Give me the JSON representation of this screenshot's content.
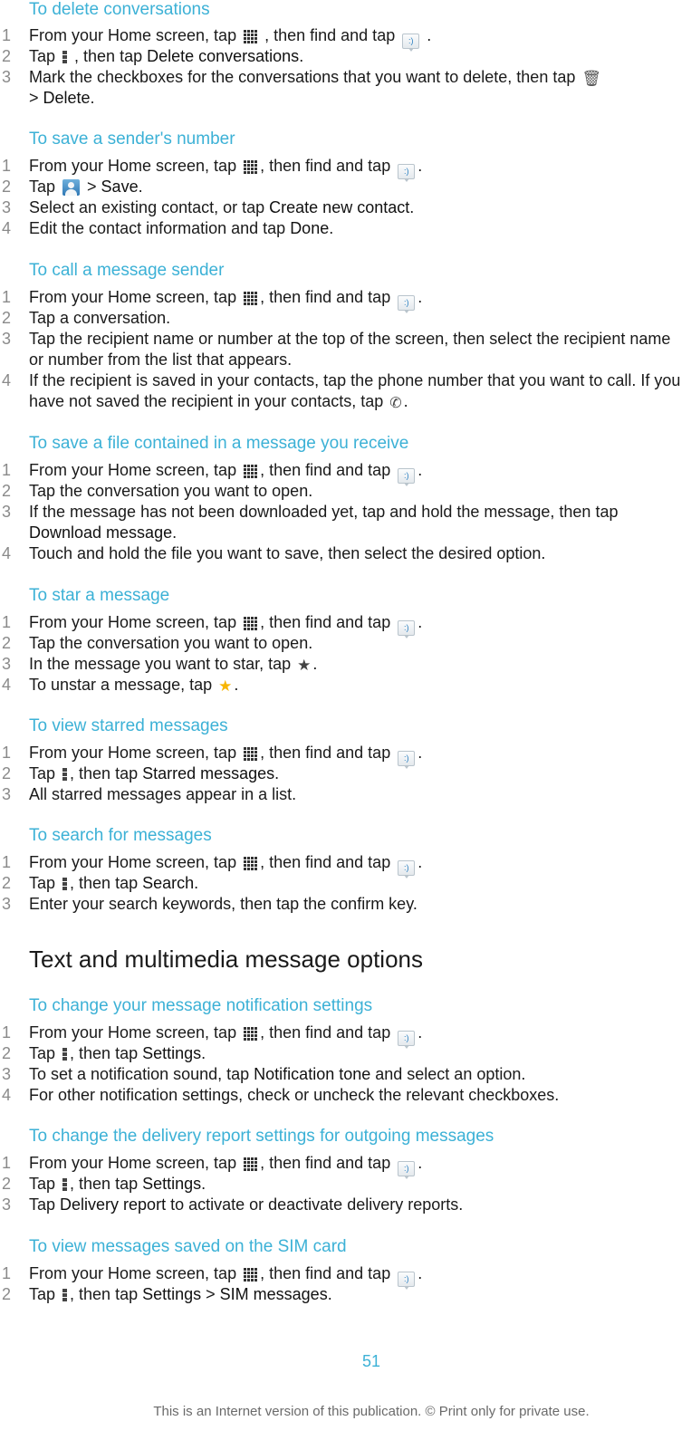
{
  "icons": {
    "apps_grid": "apps-grid-icon",
    "messaging": "messaging-icon",
    "menu": "menu-overflow-icon",
    "contact": "contact-icon",
    "trash": "trash-icon",
    "phone": "phone-icon",
    "star_dark": "star-icon",
    "star_gold": "star-filled-icon",
    "msg_glyph": ":)",
    "star_glyph": "★",
    "phone_glyph": "✆",
    "trash_glyph": "🗑"
  },
  "common": {
    "from_home_a": "From your Home screen, tap ",
    "from_home_b": ", then find and tap ",
    "period": ".",
    "tap": "Tap ",
    "then_tap": ", then tap "
  },
  "sections": {
    "delete": {
      "title": "To delete conversations",
      "step1_a": "From your Home screen, tap ",
      "step1_b": " , then find and tap ",
      "step1_c": " .",
      "step2_a": "Tap ",
      "step2_b": " , then tap ",
      "step2_bold": "Delete conversations",
      "step2_c": ".",
      "step3_a": "Mark the checkboxes for the conversations that you want to delete, then tap ",
      "step3_b": " > ",
      "step3_bold": "Delete",
      "step3_c": "."
    },
    "save_number": {
      "title": "To save a sender's number",
      "step2_b": " > ",
      "step2_bold": "Save",
      "step3_a": "Select an existing contact, or tap ",
      "step3_bold": "Create new contact",
      "step4_a": "Edit the contact information and tap ",
      "step4_bold": "Done"
    },
    "call_sender": {
      "title": "To call a message sender",
      "step2": "Tap a conversation.",
      "step3": "Tap the recipient name or number at the top of the screen, then select the recipient name or number from the list that appears.",
      "step4": "If the recipient is saved in your contacts, tap the phone number that you want to call. If you have not saved the recipient in your contacts, tap "
    },
    "save_file": {
      "title": "To save a file contained in a message you receive",
      "step2": "Tap the conversation you want to open.",
      "step3_a": "If the message has not been downloaded yet, tap and hold the message, then tap ",
      "step3_bold": "Download message",
      "step4": "Touch and hold the file you want to save, then select the desired option."
    },
    "star_message": {
      "title": "To star a message",
      "step2": "Tap the conversation you want to open.",
      "step3": "In the message you want to star, tap ",
      "step4": "To unstar a message, tap "
    },
    "view_starred": {
      "title": "To view starred messages",
      "step2_bold": "Starred messages",
      "step3": "All starred messages appear in a list."
    },
    "search": {
      "title": "To search for messages",
      "step2_bold": "Search",
      "step3": "Enter your search keywords, then tap the confirm key."
    },
    "heading": "Text and multimedia message options",
    "notification": {
      "title": "To change your message notification settings",
      "step2_bold": "Settings",
      "step3_a": "To set a notification sound, tap ",
      "step3_bold": "Notification tone",
      "step3_c": " and select an option.",
      "step4": "For other notification settings, check or uncheck the relevant checkboxes."
    },
    "delivery": {
      "title": "To change the delivery report settings for outgoing messages",
      "step2_bold": "Settings",
      "step3_bold": "Delivery report",
      "step3_c": " to activate or deactivate delivery reports."
    },
    "sim": {
      "title": "To view messages saved on the SIM card",
      "step2_bold1": "Settings",
      "step2_sep": " > ",
      "step2_bold2": "SIM messages"
    }
  },
  "numbers": [
    "1",
    "2",
    "3",
    "4"
  ],
  "page_number": "51",
  "footer": "This is an Internet version of this publication. © Print only for private use."
}
